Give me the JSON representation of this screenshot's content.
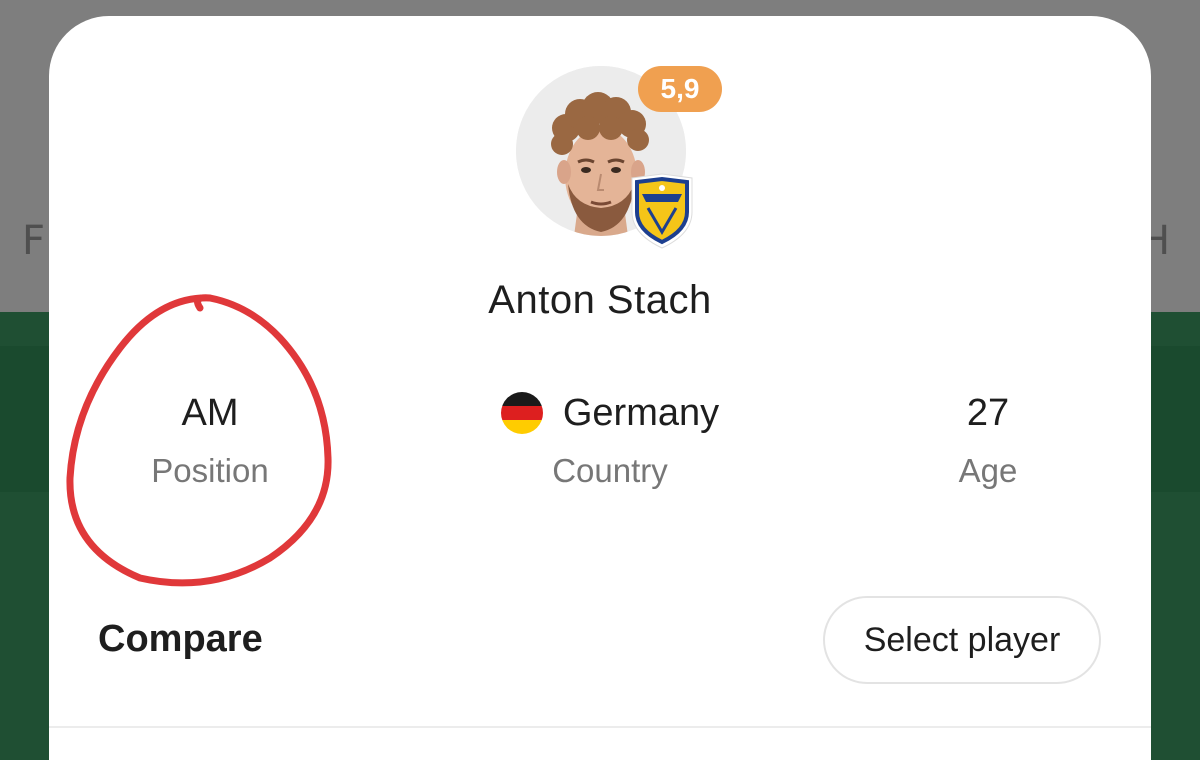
{
  "background": {
    "left_letter": "F",
    "right_letter": "H"
  },
  "player": {
    "name": "Anton Stach",
    "rating": "5,9",
    "club_icon": "leeds-united-crest-icon"
  },
  "stats": {
    "position": {
      "value": "AM",
      "label": "Position"
    },
    "country": {
      "value": "Germany",
      "label": "Country",
      "flag_icon": "germany-flag-icon"
    },
    "age": {
      "value": "27",
      "label": "Age"
    }
  },
  "compare": {
    "title": "Compare",
    "select_button": "Select player"
  },
  "colors": {
    "rating_badge": "#f0a050",
    "annotation_circle": "#e0383a",
    "background_green": "#1f4f33"
  }
}
